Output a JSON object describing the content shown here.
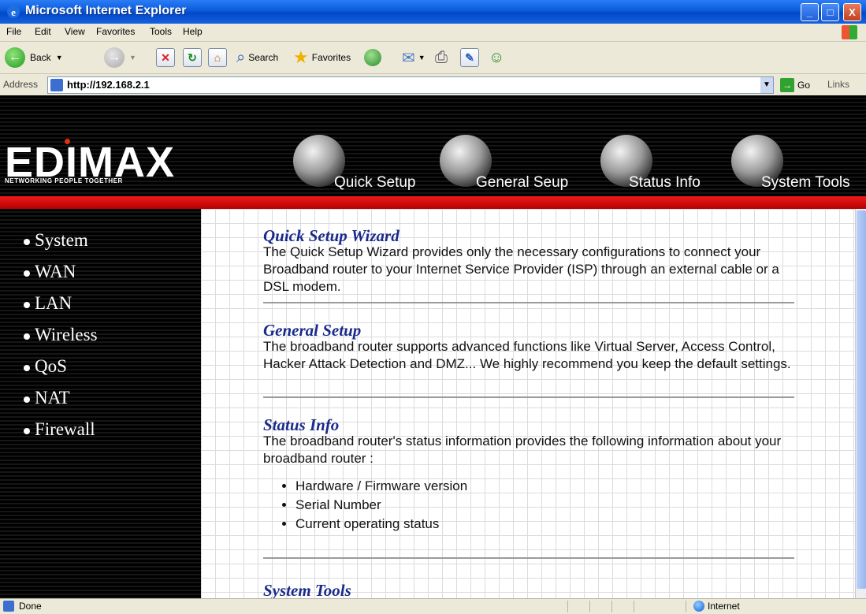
{
  "window": {
    "title": "Microsoft Internet Explorer",
    "minimize": "_",
    "maximize": "□",
    "close": "X"
  },
  "menubar": [
    "File",
    "Edit",
    "View",
    "Favorites",
    "Tools",
    "Help"
  ],
  "toolbar": {
    "back_label": "Back",
    "search_label": "Search",
    "favorites_label": "Favorites"
  },
  "address": {
    "label": "Address",
    "url": "http://192.168.2.1",
    "go_label": "Go",
    "links_label": "Links"
  },
  "router": {
    "logo": "EDIMAX",
    "tagline": "NETWORKING PEOPLE TOGETHER",
    "nav": [
      "Quick Setup",
      "General Seup",
      "Status Info",
      "System Tools"
    ]
  },
  "sidebar": {
    "items": [
      "System",
      "WAN",
      "LAN",
      "Wireless",
      "QoS",
      "NAT",
      "Firewall"
    ]
  },
  "content": {
    "sections": [
      {
        "title": "Quick Setup Wizard",
        "body": "The Quick Setup Wizard provides only the necessary configurations to connect your Broadband router to your Internet Service Provider (ISP) through an external cable or a DSL modem."
      },
      {
        "title": "General Setup",
        "body": "The broadband router supports advanced functions like Virtual Server, Access Control, Hacker Attack Detection and DMZ... We highly recommend you keep the default settings."
      },
      {
        "title": "Status Info",
        "body": "The broadband router's status information provides the following information about your broadband router :",
        "bullets": [
          "Hardware / Firmware version",
          "Serial Number",
          "Current operating status"
        ]
      }
    ]
  },
  "statusbar": {
    "status": "Done",
    "zone": "Internet"
  }
}
